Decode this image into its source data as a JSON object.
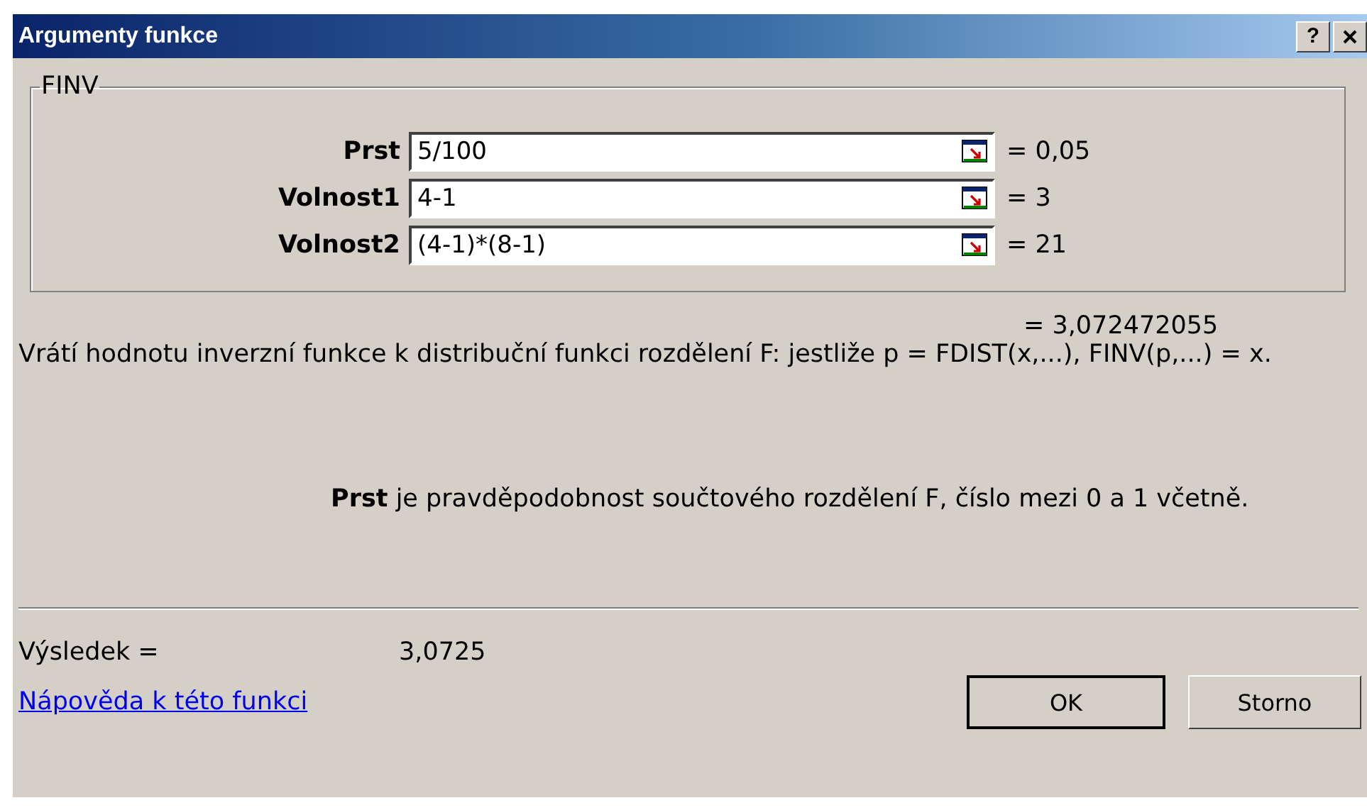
{
  "window": {
    "title": "Argumenty funkce",
    "help_button": "?"
  },
  "function_group": {
    "legend": "FINV",
    "arguments": [
      {
        "label": "Prst",
        "value": "5/100",
        "result": "= 0,05"
      },
      {
        "label": "Volnost1",
        "value": "4-1",
        "result": "= 3"
      },
      {
        "label": "Volnost2",
        "value": "(4-1)*(8-1)",
        "result": "= 21"
      }
    ]
  },
  "formula_result": "= 3,072472055",
  "description": "Vrátí hodnotu inverzní funkce k distribuční funkci rozdělení F: jestliže p = FDIST(x,...), FINV(p,...) = x.",
  "argument_help": "**Prst** je pravděpodobnost součtového rozdělení F, číslo mezi 0 a 1 včetně.",
  "result": {
    "label": "Výsledek =",
    "value": "3,0725"
  },
  "help_link": "Nápověda k této funkci",
  "buttons": [
    "OK",
    "Storno"
  ]
}
